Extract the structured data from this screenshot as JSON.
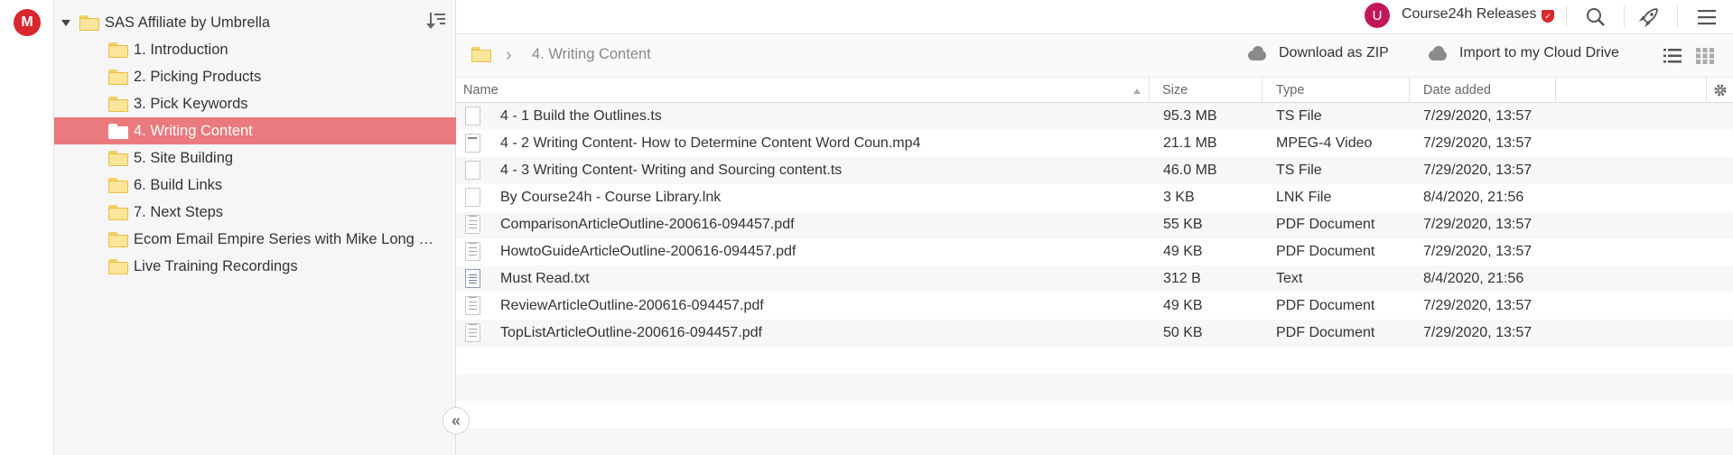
{
  "app": {
    "logo_letter": "M"
  },
  "tree": {
    "root_label": "SAS Affiliate by Umbrella",
    "items": [
      {
        "label": "1. Introduction",
        "selected": false
      },
      {
        "label": "2. Picking Products",
        "selected": false
      },
      {
        "label": "3. Pick Keywords",
        "selected": false
      },
      {
        "label": "4. Writing Content",
        "selected": true
      },
      {
        "label": "5. Site Building",
        "selected": false
      },
      {
        "label": "6. Build Links",
        "selected": false
      },
      {
        "label": "7. Next Steps",
        "selected": false
      },
      {
        "label": "Ecom Email Empire Series with Mike Long and Rob Kessler",
        "selected": false
      },
      {
        "label": "Live Training Recordings",
        "selected": false
      }
    ]
  },
  "topbar": {
    "avatar_letter": "U",
    "account_name": "Course24h Releases"
  },
  "breadcrumb": {
    "current": "4. Writing Content"
  },
  "actions": {
    "download_zip": "Download as ZIP",
    "import_cloud": "Import to my Cloud Drive"
  },
  "table": {
    "columns": {
      "name": "Name",
      "size": "Size",
      "type": "Type",
      "date": "Date added"
    },
    "rows": [
      {
        "icon": "file-icon",
        "name": "4 - 1 Build the Outlines.ts",
        "size": "95.3 MB",
        "type": "TS File",
        "date": "7/29/2020, 13:57"
      },
      {
        "icon": "video-file-icon",
        "name": "4 - 2 Writing Content- How to Determine Content Word Coun.mp4",
        "size": "21.1 MB",
        "type": "MPEG-4 Video",
        "date": "7/29/2020, 13:57"
      },
      {
        "icon": "file-icon",
        "name": "4 - 3 Writing Content- Writing and Sourcing content.ts",
        "size": "46.0 MB",
        "type": "TS File",
        "date": "7/29/2020, 13:57"
      },
      {
        "icon": "file-icon",
        "name": "By Course24h - Course Library.lnk",
        "size": "3 KB",
        "type": "LNK File",
        "date": "8/4/2020, 21:56"
      },
      {
        "icon": "pdf-file-icon",
        "name": "ComparisonArticleOutline-200616-094457.pdf",
        "size": "55 KB",
        "type": "PDF Document",
        "date": "7/29/2020, 13:57"
      },
      {
        "icon": "pdf-file-icon",
        "name": "HowtoGuideArticleOutline-200616-094457.pdf",
        "size": "49 KB",
        "type": "PDF Document",
        "date": "7/29/2020, 13:57"
      },
      {
        "icon": "text-file-icon",
        "name": "Must Read.txt",
        "size": "312 B",
        "type": "Text",
        "date": "8/4/2020, 21:56"
      },
      {
        "icon": "pdf-file-icon",
        "name": "ReviewArticleOutline-200616-094457.pdf",
        "size": "49 KB",
        "type": "PDF Document",
        "date": "7/29/2020, 13:57"
      },
      {
        "icon": "pdf-file-icon",
        "name": "TopListArticleOutline-200616-094457.pdf",
        "size": "50 KB",
        "type": "PDF Document",
        "date": "7/29/2020, 13:57"
      }
    ]
  }
}
